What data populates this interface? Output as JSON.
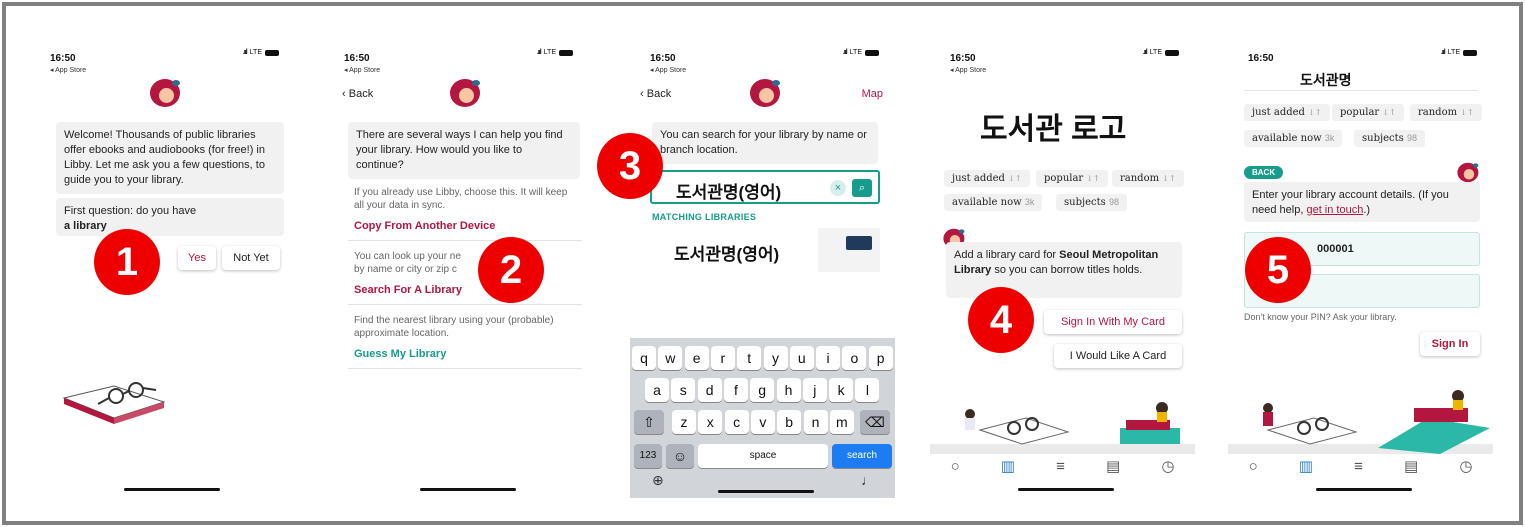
{
  "status": {
    "time": "16:50",
    "app_store": "◂ App Store",
    "network": "LTE"
  },
  "badges": [
    "1",
    "2",
    "3",
    "4",
    "5"
  ],
  "screen1": {
    "welcome": "Welcome! Thousands of public libraries offer ebooks and audiobooks (for free!) in Libby. Let me ask you a few questions, to guide you to your library.",
    "question_prefix": "First question: do you have",
    "question_bold": "a library",
    "yes": "Yes",
    "not_yet": "Not Yet"
  },
  "screen2": {
    "back": "Back",
    "intro": "There are several ways I can help you find your library. How would you like to continue?",
    "opt1_desc": "If you already use Libby, choose this. It will keep all your data in sync.",
    "opt1_link": "Copy From Another Device",
    "opt2_desc_line1": "You can look up your ne",
    "opt2_desc_line2": "by name or city or zip c",
    "opt2_link": "Search For A Library",
    "opt3_desc": "Find the nearest library using your (probable) approximate location.",
    "opt3_link": "Guess My Library"
  },
  "screen3": {
    "back": "Back",
    "map": "Map",
    "prompt": "You can search for your library by name or branch location.",
    "search_value": "도서관명(영어)",
    "matching": "MATCHING LIBRARIES",
    "result": "도서관명(영어)",
    "keys_row1": [
      "q",
      "w",
      "e",
      "r",
      "t",
      "y",
      "u",
      "i",
      "o",
      "p"
    ],
    "keys_row2": [
      "a",
      "s",
      "d",
      "f",
      "g",
      "h",
      "j",
      "k",
      "l"
    ],
    "keys_row3": [
      "z",
      "x",
      "c",
      "v",
      "b",
      "n",
      "m"
    ],
    "key_123": "123",
    "key_space": "space",
    "key_search": "search"
  },
  "screen4": {
    "logo_text": "도서관 로고",
    "tags": {
      "just_added": "just added",
      "popular": "popular",
      "random": "random",
      "available_now": "available now",
      "available_count": "3k",
      "subjects": "subjects",
      "subjects_count": "98"
    },
    "card_pre": "Add a library card for",
    "card_bold": "Seoul Metropolitan Library",
    "card_post": "so you can borrow titles",
    "card_end": "holds.",
    "signin": "Sign In With My Card",
    "want_card": "I Would Like A Card"
  },
  "screen5": {
    "title": "도서관명",
    "back_tag": "BACK",
    "enter_pre": "Enter your library account details. (If you need help,",
    "enter_link": "get in touch",
    "enter_post": ".)",
    "card_number": "000001",
    "pin_help": "Don't know your PIN? Ask your library.",
    "signin": "Sign In"
  },
  "colors": {
    "brand": "#b3163e",
    "teal": "#169c8b",
    "badge": "#ee0000",
    "frame": "#808080"
  }
}
